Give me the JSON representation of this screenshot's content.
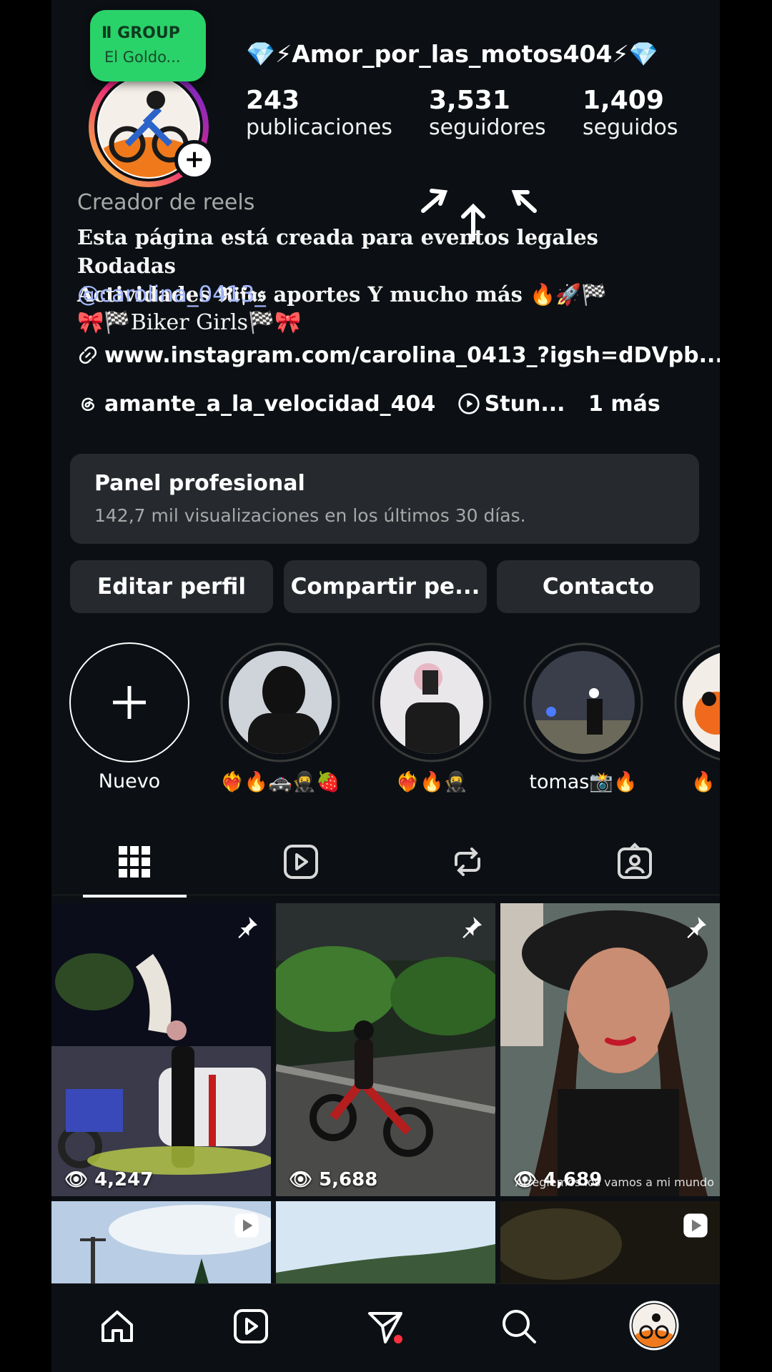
{
  "group_pill": {
    "line1": "Ⅱ GROUP",
    "line2": "El Goldo..."
  },
  "profile": {
    "username": "💎⚡Amor_por_las_motos404⚡💎",
    "stats": [
      {
        "value": "243",
        "label": "publicaciones"
      },
      {
        "value": "3,531",
        "label": "seguidores"
      },
      {
        "value": "1,409",
        "label": "seguidos"
      }
    ],
    "role": "Creador de reels",
    "bio_line1": "Esta página está creada para eventos legales Rodadas",
    "bio_line2": "Actividades 𝕽𝖎𝖋𝖆𝖘 aportes Y mucho más 🔥🚀🏁",
    "mention": "@carolina_0413_",
    "biker": "🎀🏁Biker Girls🏁🎀",
    "link": "www.instagram.com/carolina_0413_?igsh=dDVpb...",
    "threads": "amante_a_la_velocidad_404",
    "reel_link": "Stun...",
    "more": "1 más"
  },
  "panel": {
    "title": "Panel profesional",
    "subtitle": "142,7 mil visualizaciones en los últimos 30 días."
  },
  "buttons": {
    "edit": "Editar perfil",
    "share": "Compartir pe...",
    "contact": "Contacto"
  },
  "highlights": [
    {
      "label": "Nuevo"
    },
    {
      "label": "❤️‍🔥🔥🚓🥷🍓"
    },
    {
      "label": "❤️‍🔥🔥🥷"
    },
    {
      "label": "tomas📸🔥"
    },
    {
      "label": "🔥"
    }
  ],
  "posts": [
    {
      "views": "4,247",
      "pinned": true
    },
    {
      "views": "5,688",
      "pinned": true
    },
    {
      "views": "4,689",
      "pinned": true,
      "caption": "Arreglemos los vamos a mi mundo"
    }
  ],
  "colors": {
    "background": "#0c1014",
    "surface": "#262a2f",
    "group_green": "#2ad26a",
    "mention": "#a4b8ff",
    "notify_dot": "#ff3040"
  }
}
